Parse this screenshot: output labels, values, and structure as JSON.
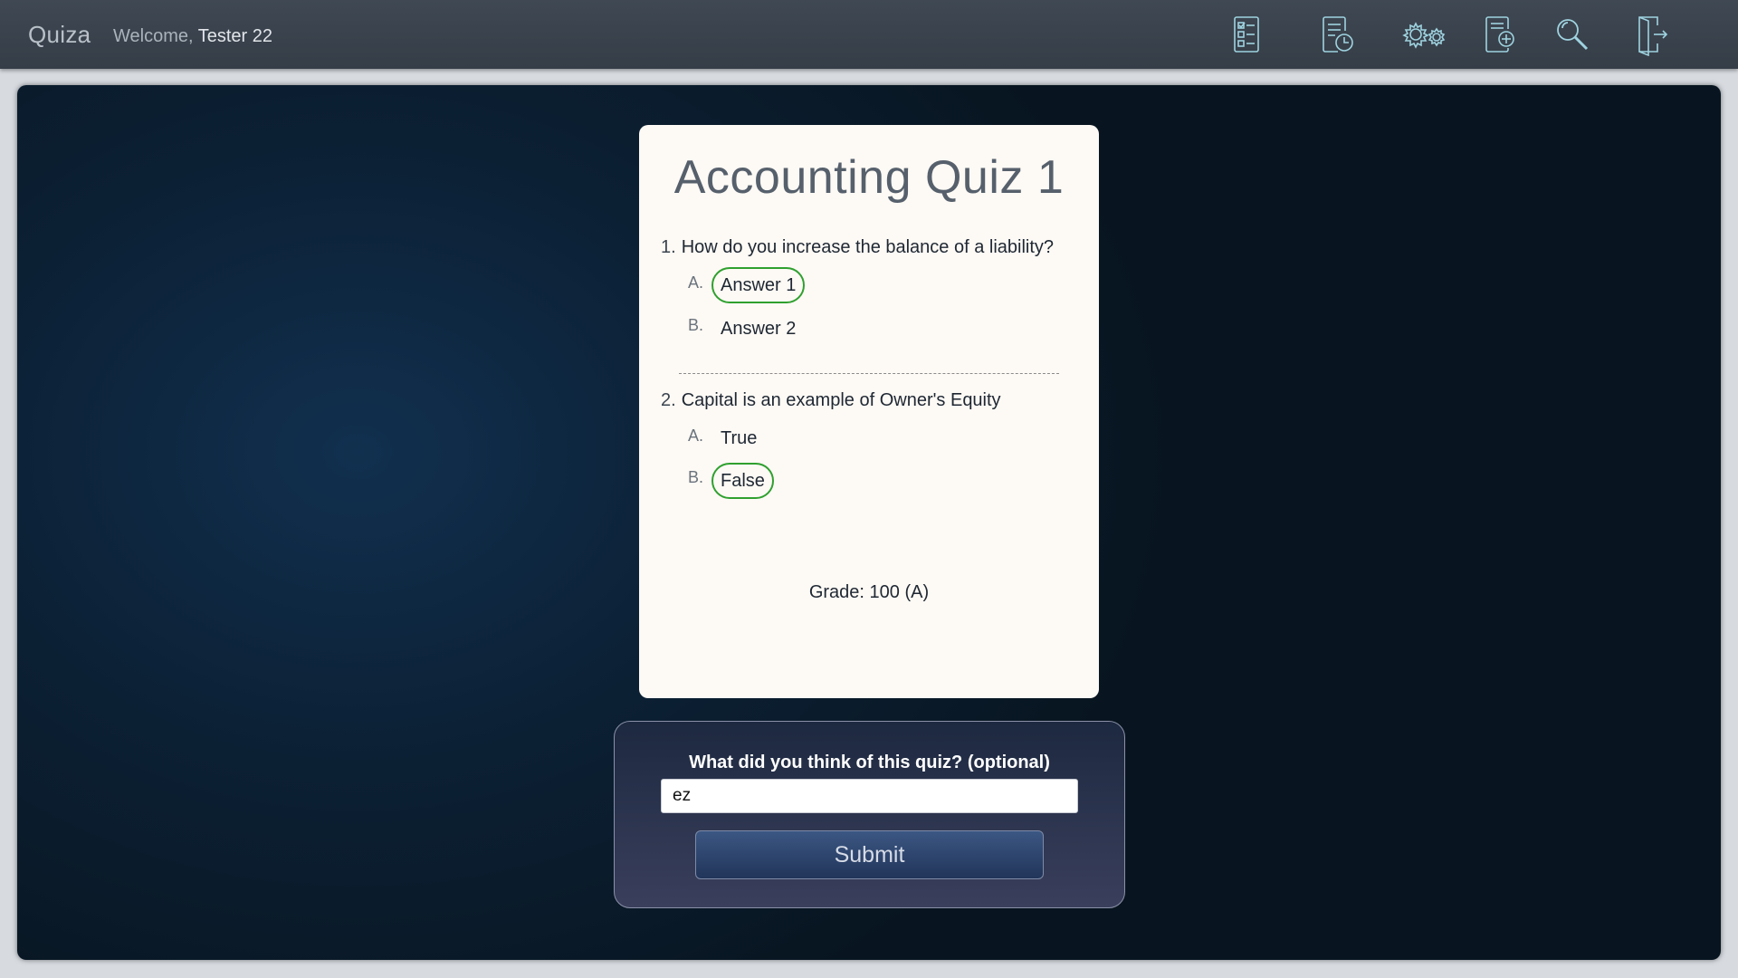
{
  "header": {
    "brand": "Quiza",
    "welcome_prefix": "Welcome,",
    "user_name": "Tester 22",
    "nav_icons": [
      "quiz-list-icon",
      "quiz-history-icon",
      "settings-icon",
      "add-quiz-icon",
      "search-icon",
      "logout-icon"
    ]
  },
  "quiz": {
    "title": "Accounting Quiz 1",
    "questions": [
      {
        "number": "1.",
        "text": "How do you increase the balance of a liability?",
        "options": [
          {
            "letter": "A.",
            "text": "Answer 1",
            "selected": true
          },
          {
            "letter": "B.",
            "text": "Answer 2",
            "selected": false
          }
        ]
      },
      {
        "number": "2.",
        "text": "Capital is an example of Owner's Equity",
        "options": [
          {
            "letter": "A.",
            "text": "True",
            "selected": false
          },
          {
            "letter": "B.",
            "text": "False",
            "selected": true
          }
        ]
      }
    ],
    "grade": "Grade: 100 (A)"
  },
  "feedback": {
    "label": "What did you think of this quiz? (optional)",
    "value": "ez",
    "submit_label": "Submit"
  },
  "colors": {
    "accent_selected": "#2fa02f",
    "topbar": "#3a424c",
    "icon_stroke": "#9fd3e0"
  }
}
